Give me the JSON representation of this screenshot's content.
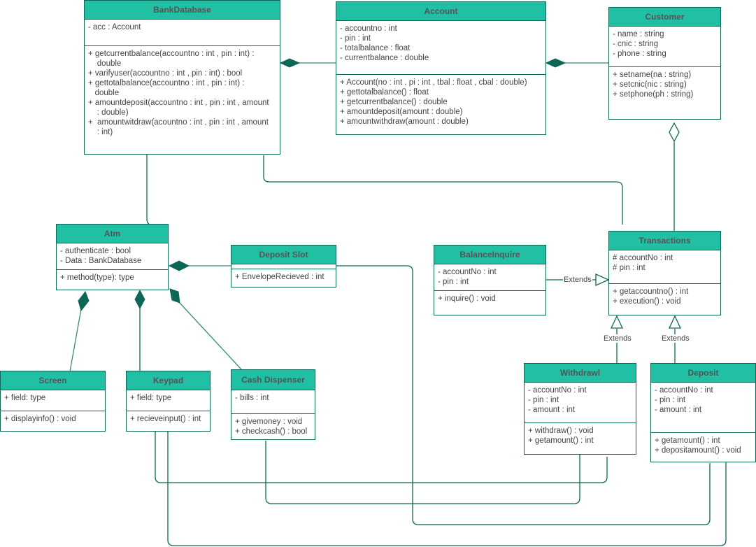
{
  "diagram": {
    "type": "UML class diagram",
    "colors": {
      "header": "#21bfa3",
      "stroke": "#0e6655",
      "text": "#444444",
      "title_text": "#545454"
    },
    "classes": {
      "bankdatabase": {
        "name": "BankDatabase",
        "attributes": [
          "- acc : Account"
        ],
        "methods": [
          "+ getcurrentbalance(accountno : int , pin : int) :",
          "    double",
          "+ varifyuser(accountno : int , pin : int) : bool",
          "+ gettotalbalance(accountno : int , pin : int) :",
          "   double",
          "+ amountdeposit(accountno : int , pin : int , amount",
          "    : double)",
          "+  amountwitdraw(acountno : int , pin : int , amount",
          "    : int)"
        ]
      },
      "account": {
        "name": "Account",
        "attributes": [
          "- accountno : int",
          "- pin : int",
          "- totalbalance : float",
          "- currentbalance : double"
        ],
        "methods": [
          "+ Account(no : int , pi : int , tbal : float , cbal : double)",
          "+ gettotalbalance() : float",
          "+ getcurrentbalance() : double",
          "+ amountdeposit(amount : double)",
          "+ amountwithdraw(amount : double)"
        ]
      },
      "customer": {
        "name": "Customer",
        "attributes": [
          "- name : string",
          "- cnic : string",
          "- phone : string"
        ],
        "methods": [
          "+ setname(na : string)",
          "+ setcnic(nic : string)",
          "+ setphone(ph : string)"
        ]
      },
      "atm": {
        "name": "Atm",
        "attributes": [
          "- authenticate : bool",
          "- Data : BankDatabase"
        ],
        "methods": [
          "+ method(type): type"
        ]
      },
      "depositslot": {
        "name": "Deposit Slot",
        "attributes": [],
        "methods": [
          "+ EnvelopeRecieved : int"
        ]
      },
      "balanceinquire": {
        "name": "BalanceInquire",
        "attributes": [
          "- accountNo : int",
          "- pin : int"
        ],
        "methods": [
          "+ inquire() : void"
        ]
      },
      "transactions": {
        "name": "Transactions",
        "attributes": [
          "# accountNo : int",
          "# pin : int"
        ],
        "methods": [
          "+ getaccountno() : int",
          "+ execution() : void"
        ]
      },
      "screen": {
        "name": "Screen",
        "attributes": [
          "+ field: type"
        ],
        "methods": [
          "+ displayinfo() : void"
        ]
      },
      "keypad": {
        "name": "Keypad",
        "attributes": [
          "+ field: type"
        ],
        "methods": [
          "+ recieveinput() : int"
        ]
      },
      "cashdispenser": {
        "name": "Cash Dispenser",
        "attributes": [
          "- bills : int"
        ],
        "methods": [
          "+ givemoney : void",
          "+ checkcash() : bool"
        ]
      },
      "withdrawl": {
        "name": "Withdrawl",
        "attributes": [
          "- accountNo : int",
          "- pin : int",
          "- amount : int"
        ],
        "methods": [
          "+ withdraw() : void",
          "+ getamount() : int"
        ]
      },
      "deposit": {
        "name": "Deposit",
        "attributes": [
          "- accountNo : int",
          "- pin : int",
          "- amount : int"
        ],
        "methods": [
          "+ getamount() : int",
          "+ depositamount() : void"
        ]
      }
    },
    "relationships": [
      {
        "from": "Account",
        "to": "BankDatabase",
        "kind": "composition",
        "label": ""
      },
      {
        "from": "Customer",
        "to": "Account",
        "kind": "composition",
        "label": ""
      },
      {
        "from": "Transactions",
        "to": "Customer",
        "kind": "aggregation",
        "label": ""
      },
      {
        "from": "BankDatabase",
        "to": "Atm",
        "kind": "association",
        "label": ""
      },
      {
        "from": "BankDatabase",
        "to": "Transactions",
        "kind": "association",
        "label": ""
      },
      {
        "from": "Deposit Slot",
        "to": "Atm",
        "kind": "composition",
        "label": ""
      },
      {
        "from": "Screen",
        "to": "Atm",
        "kind": "composition",
        "label": ""
      },
      {
        "from": "Keypad",
        "to": "Atm",
        "kind": "composition",
        "label": ""
      },
      {
        "from": "Cash Dispenser",
        "to": "Atm",
        "kind": "composition",
        "label": ""
      },
      {
        "from": "BalanceInquire",
        "to": "Transactions",
        "kind": "generalization",
        "label": "Extends"
      },
      {
        "from": "Withdrawl",
        "to": "Transactions",
        "kind": "generalization",
        "label": "Extends"
      },
      {
        "from": "Deposit",
        "to": "Transactions",
        "kind": "generalization",
        "label": "Extends"
      },
      {
        "from": "Keypad",
        "to": "Withdrawl",
        "kind": "association",
        "label": ""
      },
      {
        "from": "Cash Dispenser",
        "to": "Withdrawl",
        "kind": "association",
        "label": ""
      },
      {
        "from": "Deposit Slot",
        "to": "Deposit",
        "kind": "association",
        "label": ""
      },
      {
        "from": "Keypad",
        "to": "Deposit",
        "kind": "association",
        "label": ""
      }
    ],
    "edge_labels": {
      "balanceinquire_extends": "Extends",
      "withdrawl_extends": "Extends",
      "deposit_extends": "Extends"
    }
  }
}
